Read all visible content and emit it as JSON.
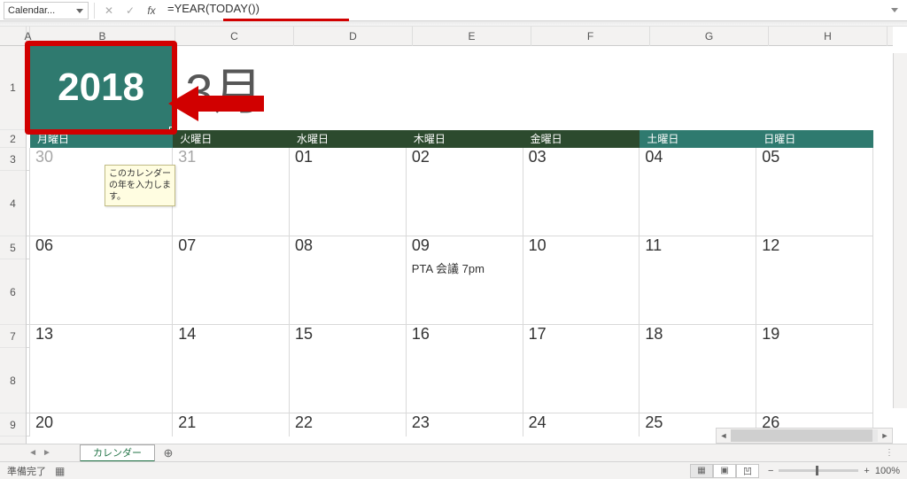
{
  "formula_bar": {
    "name_box": "Calendar...",
    "formula": "=YEAR(TODAY())"
  },
  "columns": [
    "A",
    "B",
    "C",
    "D",
    "E",
    "F",
    "G",
    "H"
  ],
  "rows_visible": [
    "1",
    "2",
    "3",
    "4",
    "5",
    "6",
    "7",
    "8",
    "9"
  ],
  "calendar": {
    "year": "2018",
    "month_partial": "3月",
    "tooltip": "このカレンダーの年を入力します。",
    "weekdays": [
      {
        "label": "月曜日",
        "style": "teal"
      },
      {
        "label": "火曜日",
        "style": "dark"
      },
      {
        "label": "水曜日",
        "style": "dark"
      },
      {
        "label": "木曜日",
        "style": "dark"
      },
      {
        "label": "金曜日",
        "style": "dark"
      },
      {
        "label": "土曜日",
        "style": "teal"
      },
      {
        "label": "日曜日",
        "style": "teal"
      }
    ],
    "weeks": [
      {
        "dates": [
          "30",
          "31",
          "01",
          "02",
          "03",
          "04",
          "05"
        ],
        "grey": [
          0,
          1
        ],
        "notes": {}
      },
      {
        "dates": [
          "06",
          "07",
          "08",
          "09",
          "10",
          "11",
          "12"
        ],
        "grey": [],
        "notes": {
          "3": "PTA 会議 7pm"
        }
      },
      {
        "dates": [
          "13",
          "14",
          "15",
          "16",
          "17",
          "18",
          "19"
        ],
        "grey": [],
        "notes": {}
      },
      {
        "dates": [
          "20",
          "21",
          "22",
          "23",
          "24",
          "25",
          "26"
        ],
        "grey": [],
        "notes": {}
      }
    ]
  },
  "tabs": {
    "active": "カレンダー"
  },
  "status": {
    "ready": "準備完了",
    "zoom": "100%"
  }
}
